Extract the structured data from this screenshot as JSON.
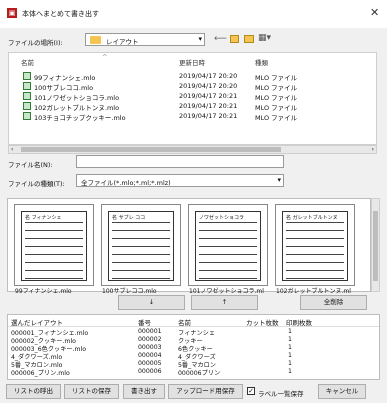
{
  "window": {
    "title": "本体へまとめて書き出す",
    "close_glyph": "✕"
  },
  "location": {
    "label": "ファイルの場所(I):",
    "value": "レイアウト"
  },
  "file_list": {
    "columns": [
      "名前",
      "更新日時",
      "種類"
    ],
    "rows": [
      {
        "name": "99フィナンシェ.mlo",
        "date": "2019/04/17 20:20",
        "type": "MLO ファイル"
      },
      {
        "name": "100サブレココ.mlo",
        "date": "2019/04/17 20:20",
        "type": "MLO ファイル"
      },
      {
        "name": "101ノワゼットショコラ.mlo",
        "date": "2019/04/17 20:21",
        "type": "MLO ファイル"
      },
      {
        "name": "102ガレットブルトンヌ.mlo",
        "date": "2019/04/17 20:21",
        "type": "MLO ファイル"
      },
      {
        "name": "103チョコチップクッキー.mlo",
        "date": "2019/04/17 20:21",
        "type": "MLO ファイル"
      }
    ]
  },
  "filename": {
    "label": "ファイル名(N):",
    "value": ""
  },
  "filetype": {
    "label": "ファイルの種類(T):",
    "value": "全ファイル(*.mlo;*.ml;*.mlz)"
  },
  "previews": [
    {
      "label": "99フィナンシェ.mlo",
      "heading": "名 フィナンシェ"
    },
    {
      "label": "100サブレココ.mlo",
      "heading": "名 サブレ ココ"
    },
    {
      "label": "101ノワゼットショコラ.ml",
      "heading": "ノワゼットショコラ"
    },
    {
      "label": "102ガレットブルトンヌ.ml",
      "heading": "名 ガレットブルトンヌ"
    }
  ],
  "move_buttons": {
    "down": "↓",
    "up": "↑",
    "delete_all": "全削除"
  },
  "selected_table": {
    "columns": [
      "選んだレイアウト",
      "番号",
      "名前",
      "カット枚数",
      "印刷枚数"
    ],
    "rows": [
      {
        "file": "000001_フィナンシェ.mlo",
        "num": "000001",
        "name": "フィナンシェ",
        "cut": "",
        "print": "1"
      },
      {
        "file": "000002_クッキー.mlo",
        "num": "000002",
        "name": "クッキー",
        "cut": "",
        "print": "1"
      },
      {
        "file": "000003_6色クッキー.mlo",
        "num": "000003",
        "name": "6色クッキー",
        "cut": "",
        "print": "1"
      },
      {
        "file": "4_ダクワーズ.mlo",
        "num": "000004",
        "name": "4_ダクワーズ",
        "cut": "",
        "print": "1"
      },
      {
        "file": "5番_マカロン.mlo",
        "num": "000005",
        "name": "5番_マカロン",
        "cut": "",
        "print": "1"
      },
      {
        "file": "000006_プリン.mlo",
        "num": "000006",
        "name": "000006プリン",
        "cut": "",
        "print": "1"
      }
    ]
  },
  "footer": {
    "list_load": "リストの呼出",
    "list_save": "リストの保存",
    "export": "書き出す",
    "upload_save": "アップロード用保存",
    "label_list_save": "ラベル一覧保存",
    "label_list_checked": true,
    "cancel": "キャンセル"
  }
}
